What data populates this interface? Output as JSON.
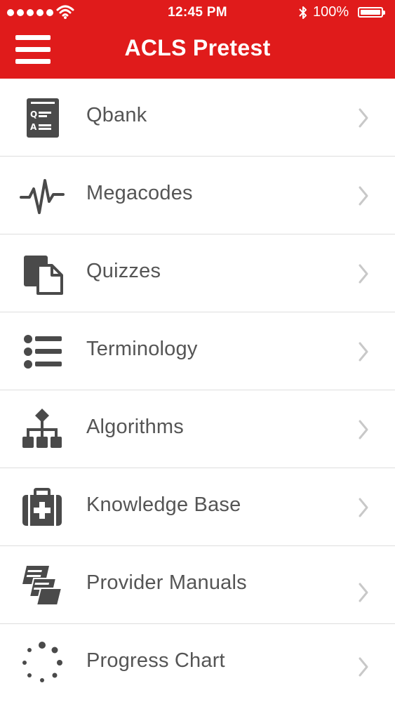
{
  "status_bar": {
    "time": "12:45 PM",
    "battery": "100%",
    "icons": [
      "signal-dots-icon",
      "wifi-icon",
      "bluetooth-icon",
      "battery-icon"
    ]
  },
  "header": {
    "title": "ACLS Pretest",
    "menu_icon": "hamburger-menu-icon",
    "background_color": "#e01b1b"
  },
  "menu": {
    "items": [
      {
        "label": "Qbank",
        "icon": "qa-sheet-icon"
      },
      {
        "label": "Megacodes",
        "icon": "heartbeat-icon"
      },
      {
        "label": "Quizzes",
        "icon": "documents-icon"
      },
      {
        "label": "Terminology",
        "icon": "bulleted-list-icon"
      },
      {
        "label": "Algorithms",
        "icon": "flowchart-icon"
      },
      {
        "label": "Knowledge Base",
        "icon": "medical-kit-icon"
      },
      {
        "label": "Provider Manuals",
        "icon": "books-icon"
      },
      {
        "label": "Progress Chart",
        "icon": "loading-dots-icon"
      }
    ]
  }
}
